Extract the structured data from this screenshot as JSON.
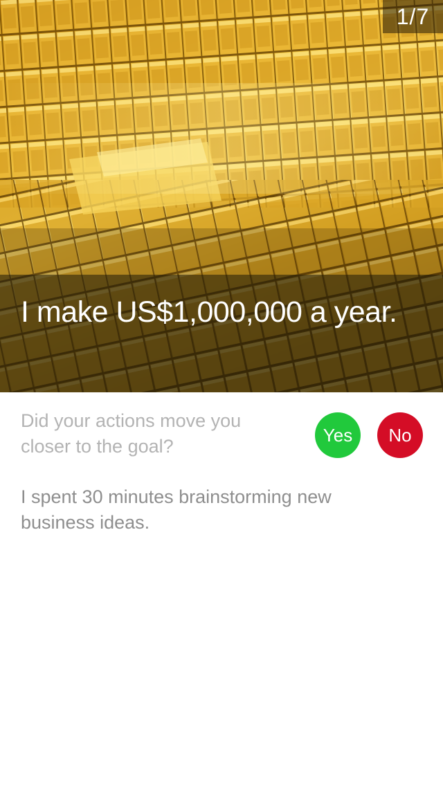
{
  "header": {
    "counter": "1/7",
    "image": "gold-bars-photo"
  },
  "goal": {
    "text": "I make US$1,000,000 a year."
  },
  "prompt": {
    "question": "Did your actions move you closer to the goal?",
    "yes_label": "Yes",
    "no_label": "No"
  },
  "action": {
    "text": "I spent 30 minutes brainstorming new business ideas."
  },
  "colors": {
    "yes": "#21c93c",
    "no": "#d40d26",
    "gold": "#e8b020"
  }
}
